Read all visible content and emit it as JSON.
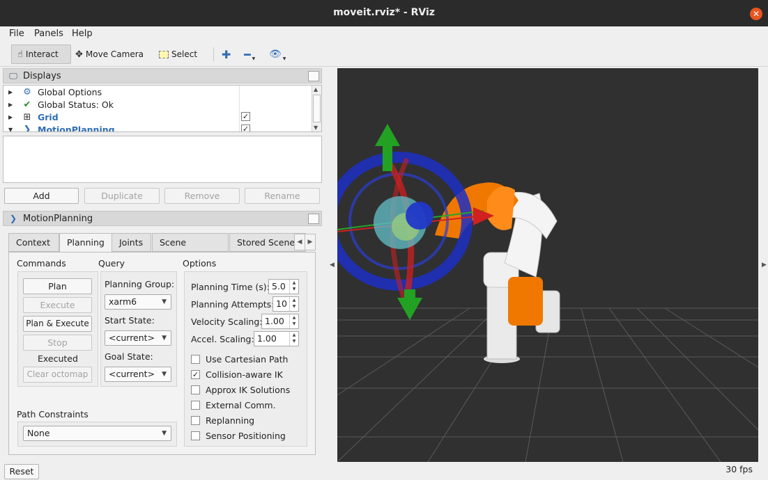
{
  "window": {
    "title": "moveit.rviz* - RViz"
  },
  "menu": [
    "File",
    "Panels",
    "Help"
  ],
  "toolbar": {
    "interact": "Interact",
    "move_camera": "Move Camera",
    "select": "Select"
  },
  "displays": {
    "title": "Displays",
    "items": [
      {
        "label": "Global Options",
        "checked": null
      },
      {
        "label": "Global Status: Ok",
        "checked": null
      },
      {
        "label": "Grid",
        "checked": true
      },
      {
        "label": "MotionPlanning",
        "checked": true
      }
    ],
    "buttons": {
      "add": "Add",
      "duplicate": "Duplicate",
      "remove": "Remove",
      "rename": "Rename"
    }
  },
  "motion_panel": {
    "title": "MotionPlanning",
    "tabs": [
      "Context",
      "Planning",
      "Joints",
      "Scene Objects",
      "Stored Scenes"
    ],
    "active_tab": "Planning",
    "commands": {
      "title": "Commands",
      "plan": "Plan",
      "execute": "Execute",
      "plan_execute": "Plan & Execute",
      "stop": "Stop",
      "status": "Executed",
      "clear_octomap": "Clear octomap"
    },
    "query": {
      "title": "Query",
      "planning_group_label": "Planning Group:",
      "planning_group": "xarm6",
      "start_state_label": "Start State:",
      "start_state": "<current>",
      "goal_state_label": "Goal State:",
      "goal_state": "<current>"
    },
    "options": {
      "title": "Options",
      "planning_time_label": "Planning Time (s):",
      "planning_time": "5.0",
      "planning_attempts_label": "Planning Attempts:",
      "planning_attempts": "10",
      "velocity_label": "Velocity Scaling:",
      "velocity": "1.00",
      "accel_label": "Accel. Scaling:",
      "accel": "1.00",
      "checkboxes": [
        {
          "label": "Use Cartesian Path",
          "checked": false
        },
        {
          "label": "Collision-aware IK",
          "checked": true
        },
        {
          "label": "Approx IK Solutions",
          "checked": false
        },
        {
          "label": "External Comm.",
          "checked": false
        },
        {
          "label": "Replanning",
          "checked": false
        },
        {
          "label": "Sensor Positioning",
          "checked": false
        }
      ]
    },
    "path_constraints": {
      "title": "Path Constraints",
      "value": "None"
    }
  },
  "status": {
    "reset": "Reset",
    "fps": "30 fps"
  },
  "colors": {
    "viewport_bg": "#303030",
    "link_orange": "#f07800",
    "ring_blue": "#1c2fc4"
  }
}
